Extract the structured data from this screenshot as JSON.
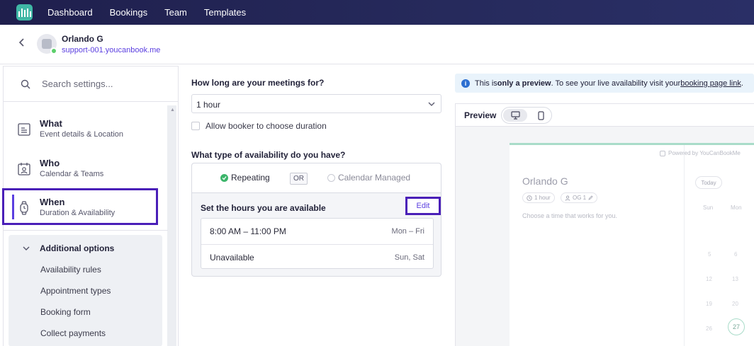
{
  "nav": {
    "items": [
      "Dashboard",
      "Bookings",
      "Team",
      "Templates"
    ]
  },
  "profile": {
    "name": "Orlando G",
    "link": "support-001.youcanbook.me"
  },
  "sidebar": {
    "search_placeholder": "Search settings...",
    "items": [
      {
        "title": "What",
        "subtitle": "Event details & Location",
        "icon": "document-icon"
      },
      {
        "title": "Who",
        "subtitle": "Calendar & Teams",
        "icon": "calendar-person-icon"
      },
      {
        "title": "When",
        "subtitle": "Duration & Availability",
        "icon": "watch-icon",
        "active": true
      }
    ],
    "additional": {
      "heading": "Additional options",
      "items": [
        "Availability rules",
        "Appointment types",
        "Booking form",
        "Collect payments"
      ]
    }
  },
  "main": {
    "duration_question": "How long are your meetings for?",
    "duration_value": "1 hour",
    "allow_booker_label": "Allow booker to choose duration",
    "allow_booker_checked": false,
    "availability_question": "What type of availability do you have?",
    "type_repeating": "Repeating",
    "type_or": "OR",
    "type_calendar": "Calendar Managed",
    "selected_type": "Repeating",
    "set_hours_label": "Set the hours you are available",
    "edit_label": "Edit",
    "hours": [
      {
        "time": "8:00 AM – 11:00 PM",
        "days": "Mon – Fri"
      },
      {
        "time": "Unavailable",
        "days": "Sun, Sat"
      }
    ]
  },
  "preview": {
    "banner_pre": "This is ",
    "banner_bold": "only a preview",
    "banner_mid": ". To see your live availability visit your ",
    "banner_link": "booking page link",
    "banner_end": ".",
    "label": "Preview",
    "mock": {
      "powered": "Powered by YouCanBookMe",
      "name": "Orlando G",
      "chip_duration": "1 hour",
      "chip_initials": "OG 1",
      "choose": "Choose a time that works for you.",
      "today": "Today",
      "days": [
        "Sun",
        "Mon"
      ],
      "dates": [
        "5",
        "6",
        "12",
        "13",
        "19",
        "20",
        "26",
        "27"
      ]
    }
  },
  "colors": {
    "nav_bg": "#1f1f4d",
    "accent": "#5b3fe0",
    "highlight": "#4a1fb8",
    "success": "#3bb56a",
    "info": "#2d6fd1"
  }
}
